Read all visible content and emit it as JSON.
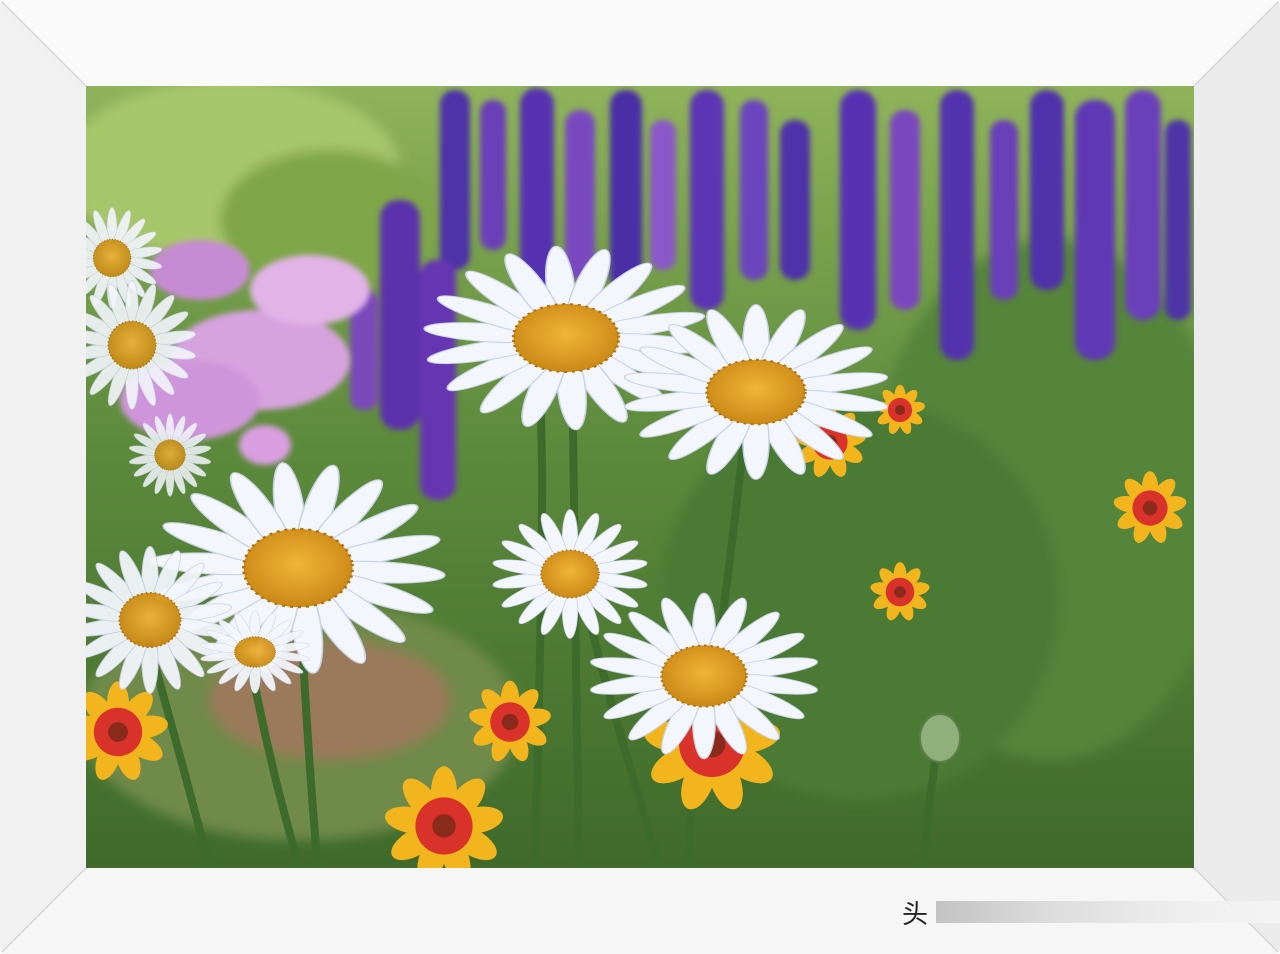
{
  "image": {
    "subject": "",
    "frame_color": "#ffffff",
    "palette": {
      "background_green": "#4f7a36",
      "light_green": "#8db44f",
      "lavender_purple": "#5a36b5",
      "violet": "#7b3fb0",
      "pink_phlox": "#d4a0e0",
      "daisy_petal": "#f4f6fb",
      "daisy_center": "#e0a21c",
      "blanket_flower_red": "#d8322a",
      "blanket_flower_yellow": "#f3b51e",
      "stem_green": "#3d6b2b"
    }
  },
  "watermark": {
    "char": "头",
    "icon": "watermark-logo-icon"
  }
}
